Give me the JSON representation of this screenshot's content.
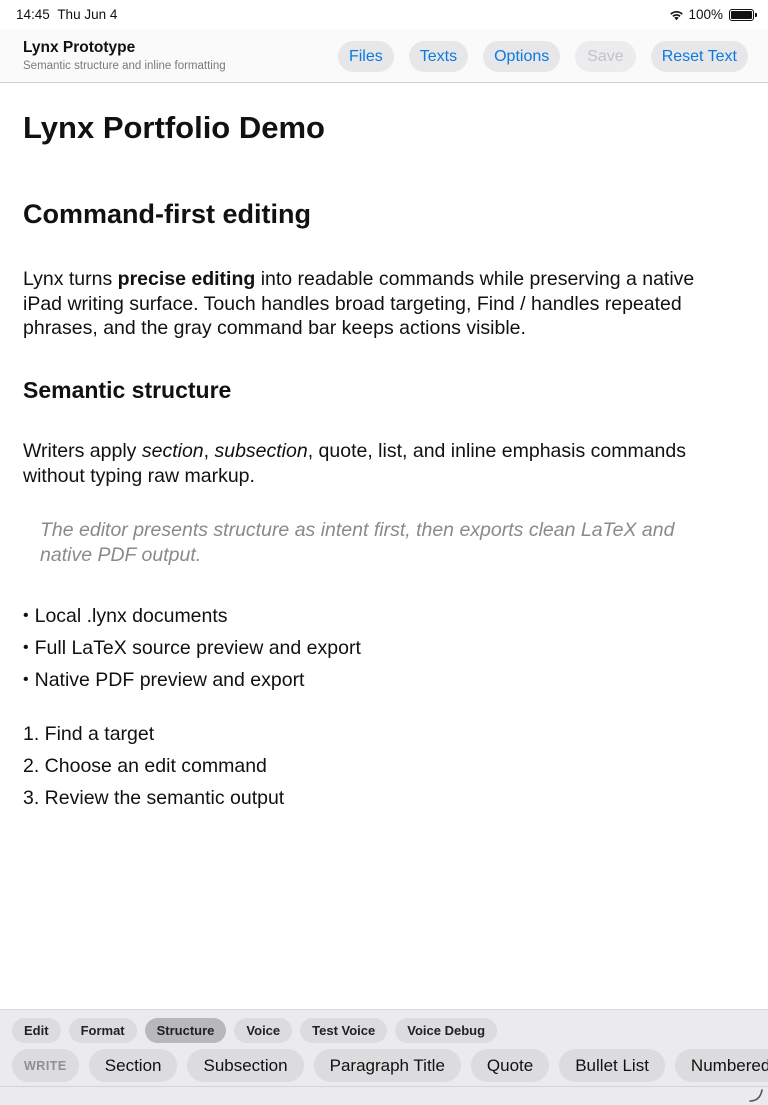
{
  "status": {
    "time": "14:45",
    "date": "Thu Jun 4",
    "battery": "100%"
  },
  "app": {
    "title": "Lynx Prototype",
    "subtitle": "Semantic structure and inline formatting"
  },
  "nav": {
    "files": "Files",
    "texts": "Texts",
    "options": "Options",
    "save": "Save",
    "reset": "Reset Text"
  },
  "doc": {
    "title": "Lynx Portfolio Demo",
    "section": "Command-first editing",
    "para1": {
      "pre": "Lynx turns ",
      "bold": "precise editing",
      "post": " into readable commands while preserving a native iPad writing surface. Touch handles broad targeting, Find / handles repeated phrases, and the gray command bar keeps actions visible."
    },
    "subsection": "Semantic structure",
    "para2": {
      "pre": "Writers apply ",
      "italic1": "section",
      "mid": ", ",
      "italic2": "subsection",
      "post": ", quote, list, and inline emphasis commands without typing raw markup."
    },
    "quote": "The editor presents structure as intent first, then exports clean LaTeX and native PDF output.",
    "bullets": [
      "Local .lynx documents",
      "Full LaTeX source preview and export",
      "Native PDF preview and export"
    ],
    "numbered": [
      "1. Find a target",
      "2. Choose an edit command",
      "3. Review the semantic output"
    ]
  },
  "toolbar": {
    "modes": [
      "Edit",
      "Format",
      "Structure",
      "Voice",
      "Test Voice",
      "Voice Debug"
    ],
    "active_mode": "Structure",
    "write_label": "WRITE",
    "commands": [
      "Section",
      "Subsection",
      "Paragraph Title",
      "Quote",
      "Bullet List",
      "Numbered List"
    ]
  }
}
